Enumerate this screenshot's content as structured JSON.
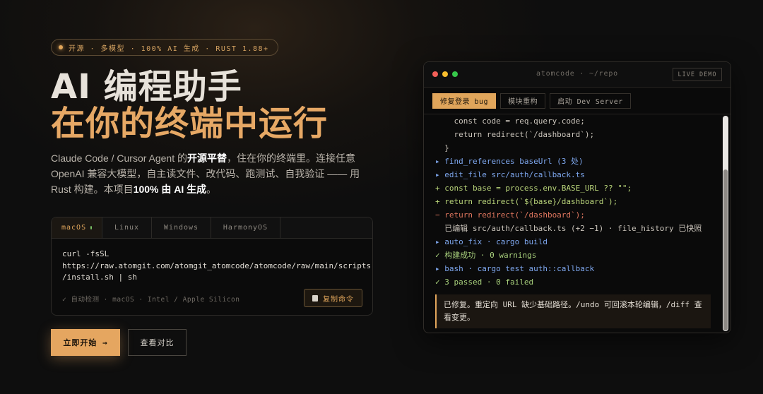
{
  "hero": {
    "badge": "开源 · 多模型 · 100% AI 生成 · RUST 1.88+",
    "title_line1": "AI 编程助手",
    "title_line2": "在你的终端中运行",
    "desc_part1": "Claude Code / Cursor Agent 的",
    "desc_bold1": "开源平替",
    "desc_part2": "，住在你的终端里。连接任意 OpenAI 兼容大模型，自主读文件、改代码、跑测试、自我验证 —— 用 Rust 构建。本项目",
    "desc_bold2": "100% 由 AI 生成",
    "desc_part3": "。"
  },
  "install": {
    "tabs": [
      "macOS",
      "Linux",
      "Windows",
      "HarmonyOS"
    ],
    "active_tab": "macOS",
    "command_line1": "curl -fsSL",
    "command_line2": "https://raw.atomgit.com/atomgit_atomcode/atomcode/raw/main/scripts",
    "command_line3": "/install.sh | sh",
    "detect_text": "✓ 自动检测 · macOS · Intel / Apple Silicon",
    "copy_label": "复制命令"
  },
  "cta": {
    "primary": "立即开始 →",
    "secondary": "查看对比"
  },
  "terminal": {
    "title": "atomcode · ~/repo",
    "live_label": "LIVE DEMO",
    "tasks": [
      "修复登录 bug",
      "模块重构",
      "启动 Dev Server"
    ],
    "lines": [
      {
        "text": "    const code = req.query.code;",
        "cls": "c-gray"
      },
      {
        "text": "    return redirect(`/dashboard`);",
        "cls": "c-gray"
      },
      {
        "text": "  }",
        "cls": "c-gray"
      },
      {
        "text": "▸ find_references baseUrl (3 处)",
        "cls": "c-blue"
      },
      {
        "text": "▸ edit_file src/auth/callback.ts",
        "cls": "c-blue"
      },
      {
        "text": "+ const base = process.env.BASE_URL ?? \"\";",
        "cls": "c-green"
      },
      {
        "text": "+ return redirect(`${base}/dashboard`);",
        "cls": "c-green"
      },
      {
        "text": "− return redirect(`/dashboard`);",
        "cls": "c-red"
      },
      {
        "text": "  已编辑 src/auth/callback.ts (+2 −1) · file_history 已快照",
        "cls": "c-gray"
      },
      {
        "text": "▸ auto_fix · cargo build",
        "cls": "c-blue"
      },
      {
        "text": "✓ 构建成功 · 0 warnings",
        "cls": "c-grn2"
      },
      {
        "text": "▸ bash · cargo test auth::callback",
        "cls": "c-blue"
      },
      {
        "text": "✓ 3 passed · 0 failed",
        "cls": "c-grn2"
      }
    ],
    "note": "已修复。重定向 URL 缺少基础路径。/undo 可回滚本轮编辑，/diff 查看变更。"
  }
}
